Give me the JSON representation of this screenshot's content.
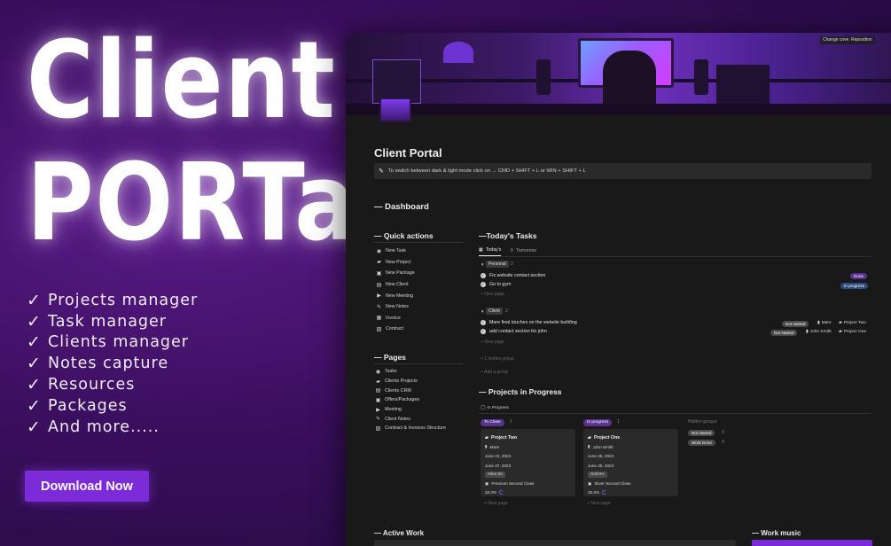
{
  "hero": {
    "line1": "Client",
    "line2": "PORTaL"
  },
  "features": [
    "Projects manager",
    "Task manager",
    "Clients manager",
    "Notes capture",
    "Resources",
    "Packages",
    "And more....."
  ],
  "check_glyph": "✓",
  "download_label": "Download Now",
  "colors": {
    "accent": "#7b2bd8",
    "purple_text": "#a873ff",
    "window_bg": "#191919"
  },
  "cover": {
    "change_cover": "Change cover",
    "reposition": "Reposition"
  },
  "page_title": "Client Portal",
  "callout": "To switch between dark & light mode click on → CMD + SHIFT + L or WIN + SHIFT + L",
  "dashboard": "— Dashboard",
  "quick_actions": {
    "title": "— Quick actions",
    "items": [
      {
        "label": "New Task",
        "icon": "check-circle-icon"
      },
      {
        "label": "New Project",
        "icon": "folder-icon"
      },
      {
        "label": "New Package",
        "icon": "package-icon"
      },
      {
        "label": "New Client",
        "icon": "client-card-icon"
      },
      {
        "label": "New Meeting",
        "icon": "video-icon"
      },
      {
        "label": "New Notes",
        "icon": "pen-icon"
      },
      {
        "label": "Invoice",
        "icon": "invoice-icon"
      },
      {
        "label": "Contract",
        "icon": "contract-icon"
      }
    ]
  },
  "pages": {
    "title": "— Pages",
    "items": [
      {
        "label": "Tasks",
        "icon": "check-circle-icon"
      },
      {
        "label": "Clients Projects",
        "icon": "folder-icon"
      },
      {
        "label": "Clients CRM",
        "icon": "crm-icon"
      },
      {
        "label": "Offers/Packages",
        "icon": "package-icon"
      },
      {
        "label": "Meeting",
        "icon": "video-icon"
      },
      {
        "label": "Client Notes",
        "icon": "pen-icon"
      },
      {
        "label": "Contract & Invoices Structure",
        "icon": "contract-icon"
      }
    ]
  },
  "todays_tasks": {
    "title": "—Today's Tasks",
    "tabs": [
      "Today's",
      "Tomorrow"
    ],
    "personal": {
      "tag": "Personal",
      "count": "2",
      "tasks": [
        {
          "name": "Fix website contact section",
          "status": "Done"
        },
        {
          "name": "Go to gym",
          "status": "In progress"
        }
      ]
    },
    "client": {
      "tag": "Client",
      "count": "2",
      "tasks": [
        {
          "name": "Mare final touches on the website building",
          "status": "Not started",
          "person": "Mare",
          "project": "Project Two"
        },
        {
          "name": "add contact section for john",
          "status": "Not started",
          "person": "John Smith",
          "project": "Project One"
        }
      ]
    },
    "new_page": "+ New page",
    "hidden_group": "> 1 hidden group",
    "add_group": "+ Add a group"
  },
  "projects": {
    "title": "— Projects in Progress",
    "view": "In Progress",
    "columns": [
      {
        "label": "To Close",
        "count": "1"
      },
      {
        "label": "In progress",
        "count": "1"
      }
    ],
    "cards": [
      {
        "title": "Project Two",
        "person": "Mare",
        "start": "June 23, 2023",
        "end": "June 27, 2023",
        "package": "Silver 6G",
        "class": "Premium Second Class",
        "progress": "33.3%"
      },
      {
        "title": "Project One",
        "person": "John Smith",
        "start": "June 26, 2023",
        "end": "June 28, 2023",
        "package": "Gold 6G",
        "class": "Silver Second Class",
        "progress": "33.3%"
      }
    ],
    "hidden_groups": {
      "title": "Hidden groups",
      "items": [
        {
          "label": "Not started",
          "count": "0"
        },
        {
          "label": "Work Done",
          "count": "0"
        }
      ]
    },
    "new_page": "+ New page"
  },
  "active_work": "— Active Work",
  "work_music": "— Work music"
}
